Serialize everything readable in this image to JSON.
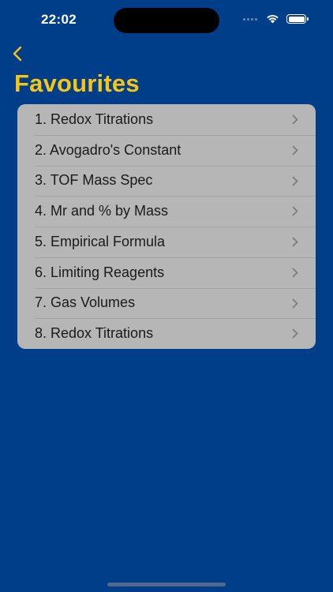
{
  "status_bar": {
    "time": "22:02",
    "icons": [
      "signal-icon",
      "wifi-icon",
      "battery-icon"
    ]
  },
  "nav": {
    "back_icon": "chevron-left-icon",
    "title": "Favourites"
  },
  "favourites": [
    {
      "label": "1. Redox Titrations"
    },
    {
      "label": "2. Avogadro's Constant"
    },
    {
      "label": "3. TOF Mass Spec"
    },
    {
      "label": "4. Mr and % by Mass"
    },
    {
      "label": "5. Empirical Formula"
    },
    {
      "label": "6. Limiting Reagents"
    },
    {
      "label": "7. Gas Volumes"
    },
    {
      "label": "8. Redox Titrations"
    }
  ],
  "colors": {
    "background": "#003e8a",
    "accent": "#f5c518",
    "list_background": "#b6b6b6",
    "text": "#1a1a1a"
  }
}
